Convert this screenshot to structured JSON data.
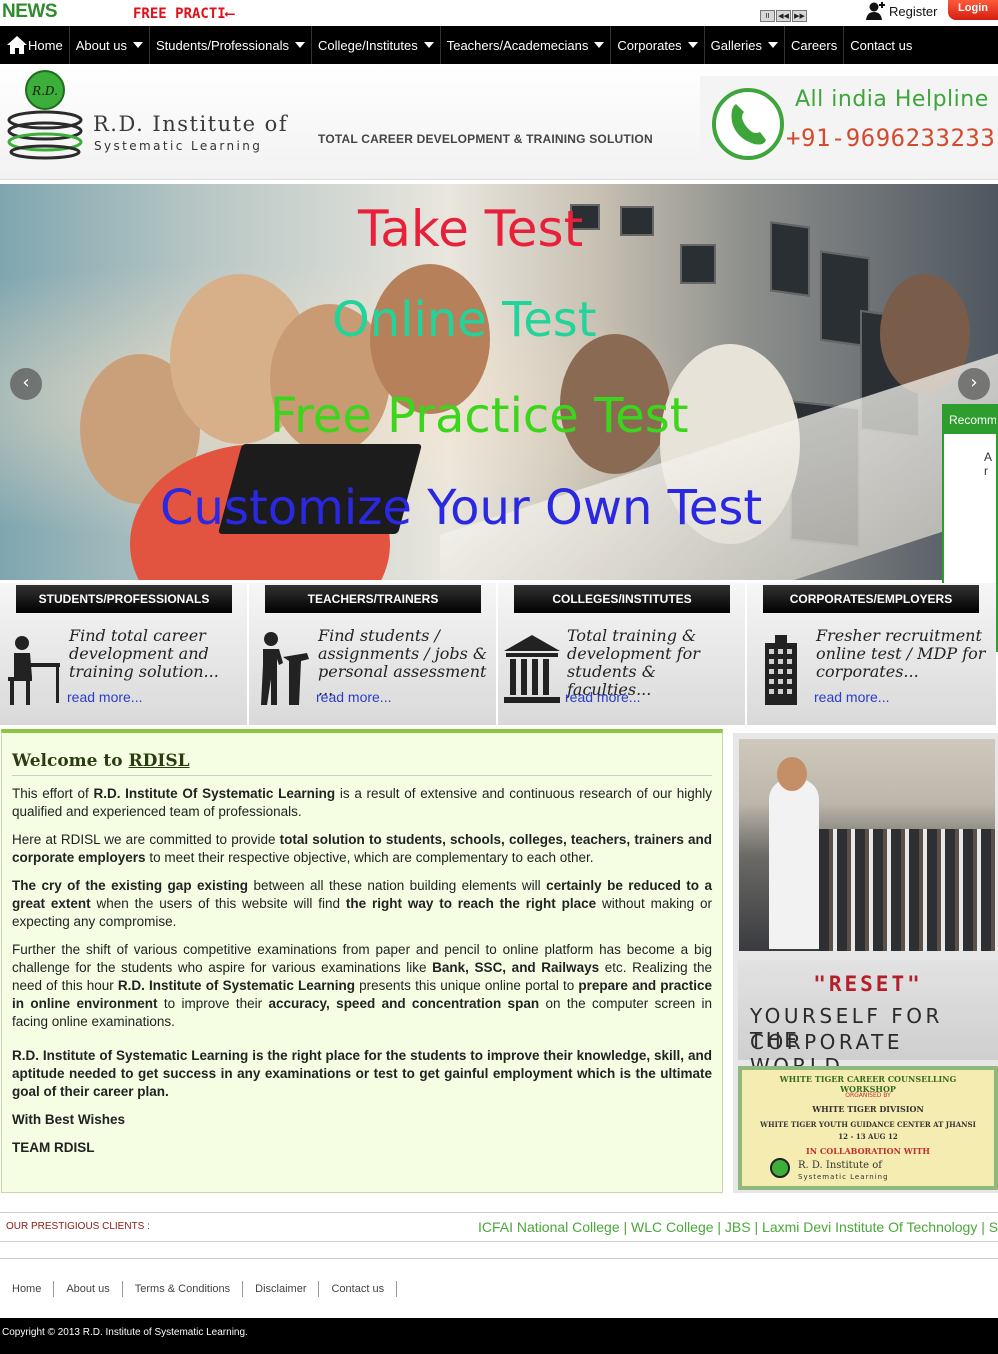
{
  "newsbar": {
    "label": "NEWS",
    "ticker_text": "FREE PRACTI",
    "ticker_arrow": "⟵",
    "controls": [
      "II",
      "◀◀",
      "▶▶"
    ],
    "register_label": "Register",
    "login_label": "Login"
  },
  "nav": {
    "items": [
      {
        "label": "Home",
        "dropdown": false
      },
      {
        "label": "About us",
        "dropdown": true
      },
      {
        "label": "Students/Professionals",
        "dropdown": true
      },
      {
        "label": "College/Institutes",
        "dropdown": true
      },
      {
        "label": "Teachers/Academecians",
        "dropdown": true
      },
      {
        "label": "Corporates",
        "dropdown": true
      },
      {
        "label": "Galleries",
        "dropdown": true
      },
      {
        "label": "Careers",
        "dropdown": false
      },
      {
        "label": "Contact us",
        "dropdown": false
      }
    ]
  },
  "header": {
    "logo_initials": "R.D.",
    "logo_title": "R.D. Institute of",
    "logo_subtitle": "Systematic Learning",
    "tagline": "TOTAL CAREER DEVELOPMENT & TRAINING SOLUTION",
    "helpline_title": "All india Helpline",
    "helpline_number": "+91-9696233233"
  },
  "banner": {
    "line1": "Take Test",
    "line2": "Online Test",
    "line3": "Free Practice Test",
    "line4": "Customize Your Own Test",
    "colors": {
      "line1": "#e8203a",
      "line2": "#22d39a",
      "line3": "#3bd61c",
      "line4": "#2a28e0"
    }
  },
  "recommend": {
    "title": "Recommend",
    "body": "A r"
  },
  "categories": [
    {
      "title": "STUDENTS/PROFESSIONALS",
      "text": "Find total career development and training solution...",
      "more": "read more...",
      "icon": "student-desk-icon"
    },
    {
      "title": "TEACHERS/TRAINERS",
      "text": "Find students / assignments / jobs & personal assessment ...",
      "more": "read more...",
      "icon": "teacher-podium-icon"
    },
    {
      "title": "COLLEGES/INSTITUTES",
      "text": "Total training & development for students & faculties...",
      "more": "read more...",
      "icon": "building-columns-icon"
    },
    {
      "title": "CORPORATES/EMPLOYERS",
      "text": "Fresher recruitment online test / MDP for corporates...",
      "more": "read more...",
      "icon": "office-tower-icon"
    }
  ],
  "welcome": {
    "title_prefix": "Welcome to ",
    "title_brand": "RDISL",
    "p1_a": "This effort of ",
    "p1_b": "R.D. Institute Of Systematic Learning",
    "p1_c": " is a result of extensive and continuous research of our highly qualified and experienced team of professionals.",
    "p2_a": "Here at RDISL we are committed to provide ",
    "p2_b": "total solution to students, schools, colleges, teachers, trainers and corporate employers",
    "p2_c": " to meet their respective objective, which are complementary to each other.",
    "p3_a": "The cry of the existing gap existing",
    "p3_b": " between all these nation building elements will ",
    "p3_c": "certainly be reduced to a great extent",
    "p3_d": " when the users of this website will find ",
    "p3_e": "the right way to reach the right place",
    "p3_f": " without making or expecting any compromise.",
    "p4_a": "Further the shift of various competitive examinations from paper and pencil to online platform has become a big challenge for the students who aspire for various examinations like ",
    "p4_b": "Bank, SSC, and Railways",
    "p4_c": " etc. Realizing the need of this hour ",
    "p4_d": "R.D. Institute of Systematic Learning",
    "p4_e": " presents this unique online portal to ",
    "p4_f": "prepare and practice in online environment",
    "p4_g": " to improve their ",
    "p4_h": "accuracy, speed and concentration span",
    "p4_i": " on the computer screen in facing online examinations.",
    "p5": "R.D. Institute of Systematic Learning is the right place for the students to improve their knowledge, skill, and aptitude needed to get success in any examinations or test to get gainful employment which is the ultimate goal of their career plan.",
    "sign1": "With Best Wishes",
    "sign2": "TEAM RDISL"
  },
  "rightcol": {
    "reset_title": "\"RESET\"",
    "reset_line1": "YOURSELF FOR THE",
    "reset_line2": "CORPORATE WORLD",
    "workshop_title": "WHITE TIGER CAREER COUNSELLING WORKSHOP",
    "workshop_org": "ORGANISED BY",
    "workshop_division": "WHITE TIGER DIVISION",
    "workshop_center": "WHITE TIGER YOUTH GUIDANCE CENTER AT JHANSI",
    "workshop_date": "12 - 13 AUG 12",
    "workshop_collab": "IN COLLABORATION WITH",
    "workshop_inst": "R. D. Institute of",
    "workshop_inst2": "Systematic Learning"
  },
  "clients": {
    "label": "OUR PRESTIGIOUS CLIENTS :",
    "list": "ICFAI National College | WLC College  | JBS | Laxmi Devi Institute Of Technology | S"
  },
  "footer": {
    "links": [
      "Home",
      "About us",
      "Terms & Conditions",
      "Disclaimer",
      "Contact us"
    ],
    "copyright": "Copyright © 2013 R.D. Institute of Systematic Learning."
  }
}
